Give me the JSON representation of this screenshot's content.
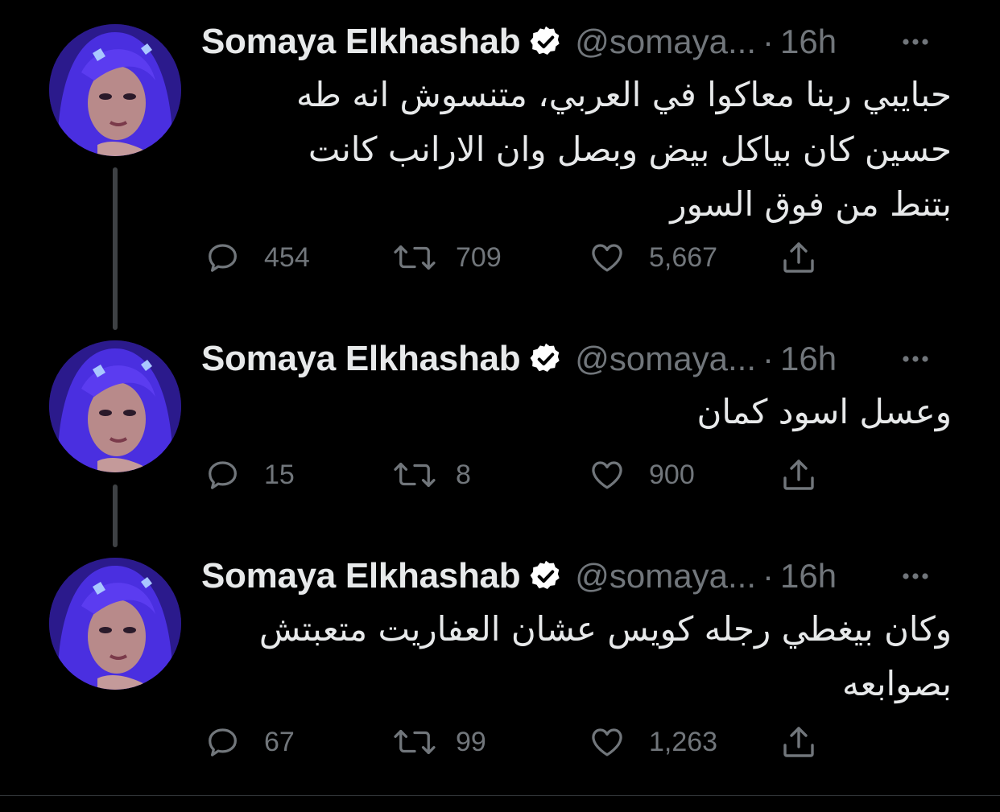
{
  "colors": {
    "background": "#000000",
    "text": "#e7e9ea",
    "secondary": "#71767b",
    "thread_line": "#3e4144",
    "verified_badge": "#ffffff"
  },
  "tweets": [
    {
      "author": {
        "name": "Somaya Elkhashab",
        "handle": "@somaya...",
        "verified": true,
        "avatar": "profile-photo"
      },
      "separator": "·",
      "time": "16h",
      "lines": [
        "حبايبي ربنا معاكوا في العربي، متنسوش انه طه",
        "حسين كان بياكل بيض وبصل وان الارانب كانت",
        "بتنط من فوق السور"
      ],
      "stats": {
        "replies": "454",
        "retweets": "709",
        "likes": "5,667"
      },
      "icons": [
        "reply-icon",
        "retweet-icon",
        "like-icon",
        "share-icon",
        "more-icon"
      ]
    },
    {
      "author": {
        "name": "Somaya Elkhashab",
        "handle": "@somaya...",
        "verified": true,
        "avatar": "profile-photo"
      },
      "separator": "·",
      "time": "16h",
      "lines": [
        "وعسل اسود كمان"
      ],
      "stats": {
        "replies": "15",
        "retweets": "8",
        "likes": "900"
      },
      "icons": [
        "reply-icon",
        "retweet-icon",
        "like-icon",
        "share-icon",
        "more-icon"
      ]
    },
    {
      "author": {
        "name": "Somaya Elkhashab",
        "handle": "@somaya...",
        "verified": true,
        "avatar": "profile-photo"
      },
      "separator": "·",
      "time": "16h",
      "lines": [
        "وكان بيغطي رجله كويس عشان العفاريت متعبتش",
        "بصوابعه"
      ],
      "stats": {
        "replies": "67",
        "retweets": "99",
        "likes": "1,263"
      },
      "icons": [
        "reply-icon",
        "retweet-icon",
        "like-icon",
        "share-icon",
        "more-icon"
      ]
    }
  ]
}
